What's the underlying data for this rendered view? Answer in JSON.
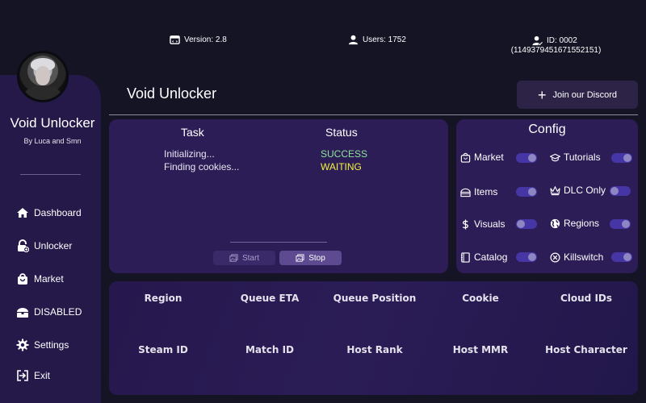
{
  "top_info": {
    "version": "Version: 2.8",
    "users": "Users: 1752",
    "id": "ID: 0002",
    "id_sub": "(1149379451671552151)"
  },
  "sidebar": {
    "app_title": "Void Unlocker",
    "subtitle": "By Luca and Smn",
    "items": [
      {
        "label": "Dashboard",
        "icon": "home-icon"
      },
      {
        "label": "Unlocker",
        "icon": "lock-icon"
      },
      {
        "label": "Market",
        "icon": "bag-icon"
      },
      {
        "label": "DISABLED",
        "icon": "chest-icon"
      },
      {
        "label": "Settings",
        "icon": "gear-icon"
      },
      {
        "label": "Exit",
        "icon": "exit-icon"
      }
    ]
  },
  "header": {
    "title": "Void Unlocker",
    "discord_button": "Join our Discord"
  },
  "task_panel": {
    "task_header": "Task",
    "status_header": "Status",
    "rows": [
      {
        "task": "Initializing...",
        "status": "SUCCESS",
        "status_color": "#8ee59a"
      },
      {
        "task": "Finding cookies...",
        "status": "WAITING",
        "status_color": "#f4f23c"
      }
    ],
    "start_label": "Start",
    "stop_label": "Stop"
  },
  "config": {
    "title": "Config",
    "items": [
      {
        "label": "Market",
        "icon": "bag-icon",
        "on": true
      },
      {
        "label": "Tutorials",
        "icon": "graduation-cap-icon",
        "on": true
      },
      {
        "label": "Items",
        "icon": "chest-icon",
        "on": true
      },
      {
        "label": "DLC Only",
        "icon": "crown-icon",
        "on": false
      },
      {
        "label": "Visuals",
        "icon": "dollar-icon",
        "on": false
      },
      {
        "label": "Regions",
        "icon": "globe-icon",
        "on": true
      },
      {
        "label": "Catalog",
        "icon": "book-icon",
        "on": true
      },
      {
        "label": "Killswitch",
        "icon": "close-circle-icon",
        "on": true
      }
    ]
  },
  "info_fields": [
    "Region",
    "Queue ETA",
    "Queue Position",
    "Cookie",
    "Cloud IDs",
    "Steam ID",
    "Match ID",
    "Host Rank",
    "Host MMR",
    "Host Character"
  ],
  "colors": {
    "background": "#141425",
    "sidebar": "#25194a",
    "panel": "#2c1d57",
    "toggle_track": "#4636a5",
    "success": "#8ee59a",
    "waiting": "#f4f23c"
  }
}
